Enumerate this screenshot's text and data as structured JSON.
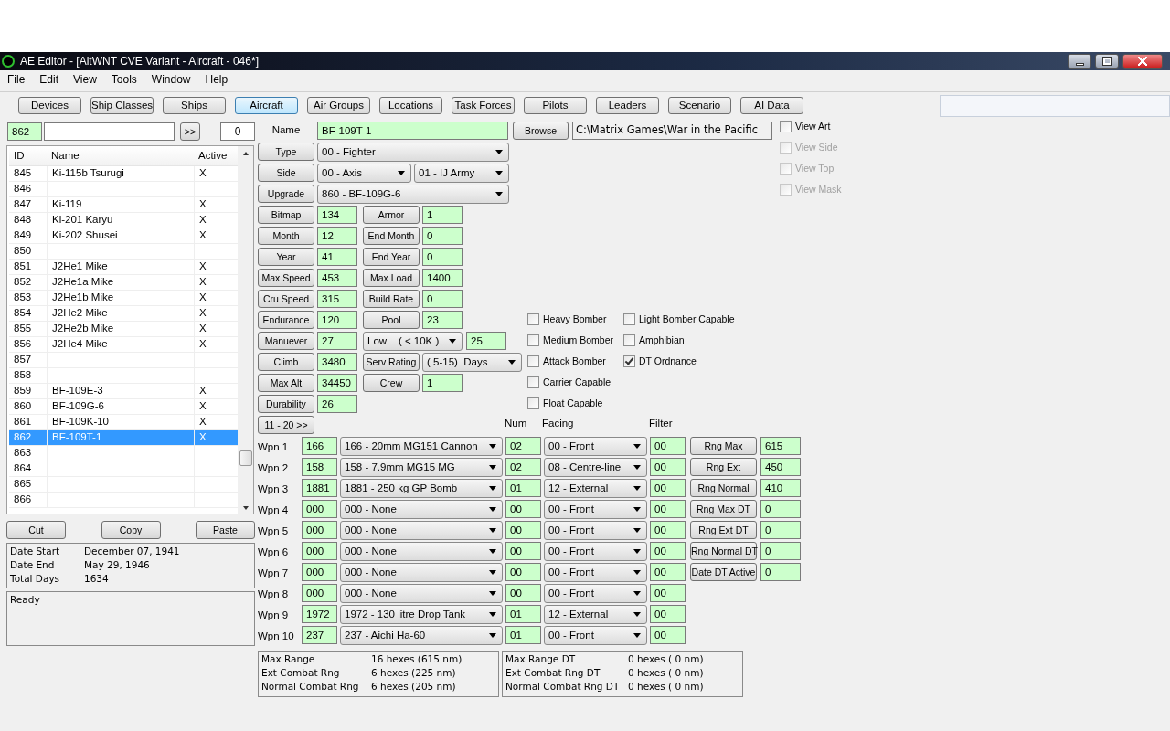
{
  "window": {
    "title": "AE Editor - [AltWNT CVE Variant - Aircraft - 046*]"
  },
  "menu": [
    "File",
    "Edit",
    "View",
    "Tools",
    "Window",
    "Help"
  ],
  "toolbar": [
    {
      "label": "Devices",
      "selected": false
    },
    {
      "label": "Ship Classes",
      "selected": false
    },
    {
      "label": "Ships",
      "selected": false
    },
    {
      "label": "Aircraft",
      "selected": true
    },
    {
      "label": "Air Groups",
      "selected": false
    },
    {
      "label": "Locations",
      "selected": false
    },
    {
      "label": "Task Forces",
      "selected": false
    },
    {
      "label": "Pilots",
      "selected": false
    },
    {
      "label": "Leaders",
      "selected": false
    },
    {
      "label": "Scenario",
      "selected": false
    },
    {
      "label": "AI Data",
      "selected": false
    }
  ],
  "search": {
    "id_value": "862",
    "go_button": ">>",
    "count": "0"
  },
  "list": {
    "columns": [
      "ID",
      "Name",
      "Active"
    ],
    "rows": [
      {
        "id": "845",
        "name": "Ki-115b Tsurugi",
        "active": "X",
        "selected": false
      },
      {
        "id": "846",
        "selected": false
      },
      {
        "id": "847",
        "name": "Ki-119",
        "active": "X",
        "selected": false
      },
      {
        "id": "848",
        "name": "Ki-201 Karyu",
        "active": "X",
        "selected": false
      },
      {
        "id": "849",
        "name": "Ki-202 Shusei",
        "active": "X",
        "selected": false
      },
      {
        "id": "850",
        "selected": false
      },
      {
        "id": "851",
        "name": "J2He1 Mike",
        "active": "X",
        "selected": false
      },
      {
        "id": "852",
        "name": "J2He1a Mike",
        "active": "X",
        "selected": false
      },
      {
        "id": "853",
        "name": "J2He1b Mike",
        "active": "X",
        "selected": false
      },
      {
        "id": "854",
        "name": "J2He2 Mike",
        "active": "X",
        "selected": false
      },
      {
        "id": "855",
        "name": "J2He2b Mike",
        "active": "X",
        "selected": false
      },
      {
        "id": "856",
        "name": "J2He4 Mike",
        "active": "X",
        "selected": false
      },
      {
        "id": "857",
        "selected": false
      },
      {
        "id": "858",
        "selected": false
      },
      {
        "id": "859",
        "name": "BF-109E-3",
        "active": "X",
        "selected": false
      },
      {
        "id": "860",
        "name": "BF-109G-6",
        "active": "X",
        "selected": false
      },
      {
        "id": "861",
        "name": "BF-109K-10",
        "active": "X",
        "selected": false
      },
      {
        "id": "862",
        "name": "BF-109T-1",
        "active": "X",
        "selected": true
      },
      {
        "id": "863",
        "selected": false
      },
      {
        "id": "864",
        "selected": false
      },
      {
        "id": "865",
        "selected": false
      },
      {
        "id": "866",
        "selected": false
      }
    ]
  },
  "edit_buttons": [
    "Cut",
    "Copy",
    "Paste"
  ],
  "dates": [
    {
      "label": "Date Start",
      "value": "December 07, 1941"
    },
    {
      "label": "Date End",
      "value": "May 29, 1946"
    },
    {
      "label": "Total Days",
      "value": "1634"
    }
  ],
  "status": "Ready",
  "name_row": {
    "label": "Name",
    "value": "BF-109T-1",
    "browse": "Browse",
    "path": "C:\\Matrix Games\\War in the Pacific"
  },
  "view_checks": [
    {
      "label": "View Art",
      "checked": false,
      "disabled": false
    },
    {
      "label": "View Side",
      "checked": false,
      "disabled": true
    },
    {
      "label": "View Top",
      "checked": false,
      "disabled": true
    },
    {
      "label": "View Mask",
      "checked": false,
      "disabled": true
    }
  ],
  "rows": [
    {
      "kind": "select",
      "button": "Type",
      "values": [
        "00 - Fighter"
      ]
    },
    {
      "kind": "select",
      "button": "Side",
      "values": [
        "00 - Axis",
        "01 - IJ Army"
      ]
    },
    {
      "kind": "select",
      "button": "Upgrade",
      "values": [
        "860 - BF-109G-6"
      ]
    },
    {
      "kind": "pair",
      "button": "Bitmap",
      "value": "134",
      "button2": "Armor",
      "value2": "1"
    },
    {
      "kind": "pair",
      "button": "Month",
      "value": "12",
      "button2": "End Month",
      "value2": "0"
    },
    {
      "kind": "pair",
      "button": "Year",
      "value": "41",
      "button2": "End Year",
      "value2": "0"
    },
    {
      "kind": "pair",
      "button": "Max Speed",
      "value": "453",
      "button2": "Max Load",
      "value2": "1400"
    },
    {
      "kind": "pair",
      "button": "Cru Speed",
      "value": "315",
      "button2": "Build Rate",
      "value2": "0"
    },
    {
      "kind": "pair",
      "button": "Endurance",
      "value": "120",
      "button2": "Pool",
      "value2": "23"
    },
    {
      "kind": "select_field",
      "button": "Manuever",
      "value": "27",
      "select": "Low    ( < 10K )",
      "value2": "25"
    },
    {
      "kind": "button_select",
      "button": "Climb",
      "value": "3480",
      "button2": "Serv Rating",
      "select": "( 5-15)  Days"
    },
    {
      "kind": "pair",
      "button": "Max Alt",
      "value": "34450",
      "button2": "Crew",
      "value2": "1"
    },
    {
      "kind": "single",
      "button": "Durability",
      "value": "26"
    }
  ],
  "flags": [
    [
      {
        "label": "Heavy Bomber",
        "checked": false
      },
      {
        "label": "Medium Bomber",
        "checked": false
      },
      {
        "label": "Attack Bomber",
        "checked": false
      },
      {
        "label": "Carrier Capable",
        "checked": false
      },
      {
        "label": "Float Capable",
        "checked": false
      }
    ],
    [
      {
        "label": "Light Bomber Capable",
        "checked": false
      },
      {
        "label": "Amphibian",
        "checked": false
      },
      {
        "label": "DT Ordnance",
        "checked": true
      }
    ]
  ],
  "weapons_header": {
    "page_button": "11 - 20 >>",
    "num": "Num",
    "facing": "Facing",
    "filter": "Filter"
  },
  "weapons": [
    {
      "label": "Wpn 1",
      "id": "166",
      "device": "166 - 20mm MG151 Cannon",
      "num": "02",
      "facing": "00 - Front",
      "filter": "00"
    },
    {
      "label": "Wpn 2",
      "id": "158",
      "device": "158 - 7.9mm MG15 MG",
      "num": "02",
      "facing": "08 - Centre-line",
      "filter": "00"
    },
    {
      "label": "Wpn 3",
      "id": "1881",
      "device": "1881 - 250 kg GP Bomb",
      "num": "01",
      "facing": "12 - External",
      "filter": "00"
    },
    {
      "label": "Wpn 4",
      "id": "000",
      "device": "000 - None",
      "num": "00",
      "facing": "00 - Front",
      "filter": "00"
    },
    {
      "label": "Wpn 5",
      "id": "000",
      "device": "000 - None",
      "num": "00",
      "facing": "00 - Front",
      "filter": "00"
    },
    {
      "label": "Wpn 6",
      "id": "000",
      "device": "000 - None",
      "num": "00",
      "facing": "00 - Front",
      "filter": "00"
    },
    {
      "label": "Wpn 7",
      "id": "000",
      "device": "000 - None",
      "num": "00",
      "facing": "00 - Front",
      "filter": "00"
    },
    {
      "label": "Wpn 8",
      "id": "000",
      "device": "000 - None",
      "num": "00",
      "facing": "00 - Front",
      "filter": "00"
    },
    {
      "label": "Wpn 9",
      "id": "1972",
      "device": "1972 - 130 litre Drop Tank",
      "num": "01",
      "facing": "12 - External",
      "filter": "00"
    },
    {
      "label": "Wpn 10",
      "id": "237",
      "device": "237 - Aichi Ha-60",
      "num": "01",
      "facing": "00 - Front",
      "filter": "00"
    }
  ],
  "ranges": [
    {
      "button": "Rng Max",
      "value": "615"
    },
    {
      "button": "Rng Ext",
      "value": "450"
    },
    {
      "button": "Rng Normal",
      "value": "410"
    },
    {
      "button": "Rng Max DT",
      "value": "0"
    },
    {
      "button": "Rng Ext DT",
      "value": "0"
    },
    {
      "button": "Rng Normal DT",
      "value": "0"
    },
    {
      "button": "Date DT Active",
      "value": "0"
    }
  ],
  "summary": [
    [
      {
        "label": "Max Range",
        "value": "16 hexes (615 nm)"
      },
      {
        "label": "Ext Combat Rng",
        "value": "6 hexes (225 nm)"
      },
      {
        "label": "Normal Combat Rng",
        "value": "6 hexes (205 nm)"
      }
    ],
    [
      {
        "label": "Max Range DT",
        "value": "0 hexes ( 0 nm)"
      },
      {
        "label": "Ext Combat Rng DT",
        "value": "0 hexes ( 0 nm)"
      },
      {
        "label": "Normal Combat Rng DT",
        "value": "0 hexes ( 0 nm)"
      }
    ]
  ]
}
